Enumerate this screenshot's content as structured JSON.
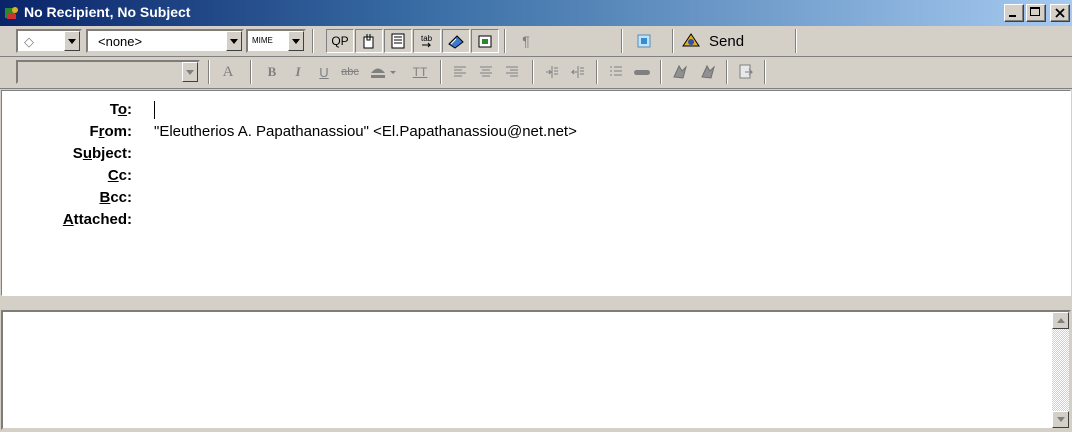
{
  "window": {
    "title": "No Recipient, No Subject"
  },
  "toolbar1": {
    "priority_symbol": "◇",
    "stationery_value": "<none>",
    "encoding_value": "MIME",
    "qp_label": "QP",
    "send_label": "Send",
    "pilcrow": "¶"
  },
  "toolbar2": {
    "font_value": "",
    "font_size_label": "A",
    "bold": "B",
    "italic": "I",
    "underline": "U",
    "strike": "abc",
    "teletype": "TT"
  },
  "headers": {
    "to_label": {
      "pre": "T",
      "key": "o",
      "post": ":"
    },
    "to_value": "",
    "from_label": {
      "pre": "F",
      "key": "r",
      "post": "om:"
    },
    "from_value": "\"Eleutherios A. Papathanassiou\" <El.Papathanassiou@net.net>",
    "subject_label": {
      "pre": "S",
      "key": "u",
      "post": "bject:"
    },
    "subject_value": "",
    "cc_label": {
      "pre": "",
      "key": "C",
      "post": "c:"
    },
    "cc_value": "",
    "bcc_label": {
      "pre": "",
      "key": "B",
      "post": "cc:"
    },
    "bcc_value": "",
    "attached_label": {
      "pre": "",
      "key": "A",
      "post": "ttached:"
    },
    "attached_value": ""
  },
  "body": {
    "text": ""
  },
  "colors": {
    "titlebar_start": "#0a246a",
    "titlebar_end": "#a6caf0",
    "chrome": "#d4d0c8"
  }
}
